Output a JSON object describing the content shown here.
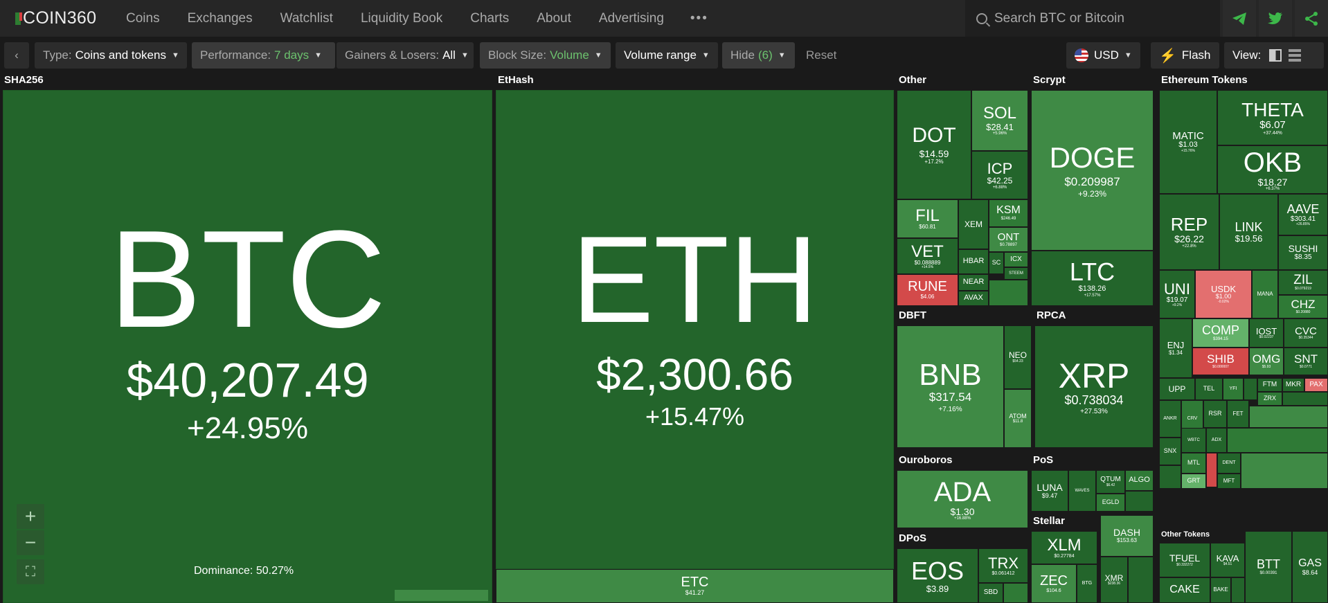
{
  "logo": {
    "text": "COIN360"
  },
  "nav": {
    "coins": "Coins",
    "exchanges": "Exchanges",
    "watchlist": "Watchlist",
    "liquidity": "Liquidity Book",
    "charts": "Charts",
    "about": "About",
    "advertising": "Advertising",
    "more": "•••"
  },
  "search": {
    "placeholder": "Search BTC or Bitcoin"
  },
  "toolbar": {
    "back": "‹",
    "type_label": "Type:",
    "type_value": "Coins and tokens",
    "perf_label": "Performance:",
    "perf_value": "7 days",
    "gl_label": "Gainers & Losers:",
    "gl_value": "All",
    "block_label": "Block Size:",
    "block_value": "Volume",
    "volume_range": "Volume range",
    "hide_label": "Hide",
    "hide_value": "(6)",
    "reset": "Reset",
    "currency": "USD",
    "flash": "Flash",
    "view": "View:"
  },
  "sections": {
    "sha256": "SHA256",
    "ethash": "EtHash",
    "other": "Other",
    "scrypt": "Scrypt",
    "eth_tokens": "Ethereum Tokens",
    "dbft": "DBFT",
    "rpca": "RPCA",
    "ouroboros": "Ouroboros",
    "pos": "PoS",
    "stellar": "Stellar",
    "dpos": "DPoS",
    "other_tokens": "Other Tokens"
  },
  "dominance": "Dominance: 50.27%",
  "tiles": {
    "btc": {
      "s": "BTC",
      "p": "$40,207.49",
      "c": "+24.95%"
    },
    "eth": {
      "s": "ETH",
      "p": "$2,300.66",
      "c": "+15.47%"
    },
    "etc": {
      "s": "ETC",
      "p": "$41.27"
    },
    "dot": {
      "s": "DOT",
      "p": "$14.59",
      "c": "+17.2%"
    },
    "sol": {
      "s": "SOL",
      "p": "$28.41",
      "c": "+5.96%"
    },
    "icp": {
      "s": "ICP",
      "p": "$42.25",
      "c": "+6.88%"
    },
    "fil": {
      "s": "FIL",
      "p": "$60.81",
      "c": "+4.9%"
    },
    "xem": {
      "s": "XEM"
    },
    "ksm": {
      "s": "KSM",
      "p": "$246.49"
    },
    "ont": {
      "s": "ONT",
      "p": "$0.78897"
    },
    "vet": {
      "s": "VET",
      "p": "$0.088889",
      "c": "+14.5%"
    },
    "hbar": {
      "s": "HBAR"
    },
    "sc": {
      "s": "SC"
    },
    "icx": {
      "s": "ICX"
    },
    "steem": {
      "s": "STEEM"
    },
    "rune": {
      "s": "RUNE",
      "p": "$4.06"
    },
    "near": {
      "s": "NEAR"
    },
    "avax": {
      "s": "AVAX"
    },
    "doge": {
      "s": "DOGE",
      "p": "$0.209987",
      "c": "+9.23%"
    },
    "ltc": {
      "s": "LTC",
      "p": "$138.26",
      "c": "+17.57%"
    },
    "matic": {
      "s": "MATIC",
      "p": "$1.03",
      "c": "+15.76%"
    },
    "theta": {
      "s": "THETA",
      "p": "$6.07",
      "c": "+37.44%"
    },
    "okb": {
      "s": "OKB",
      "p": "$18.27",
      "c": "+6.37%"
    },
    "rep": {
      "s": "REP",
      "p": "$26.22",
      "c": "+22.8%"
    },
    "link": {
      "s": "LINK",
      "p": "$19.56"
    },
    "aave": {
      "s": "AAVE",
      "p": "$303.41",
      "c": "+26.85%"
    },
    "sushi": {
      "s": "SUSHI",
      "p": "$8.35"
    },
    "uni": {
      "s": "UNI",
      "p": "$19.07",
      "c": "+9.2%"
    },
    "usdk": {
      "s": "USDK",
      "p": "$1.00",
      "c": "-0.02%"
    },
    "mana": {
      "s": "MANA"
    },
    "zil": {
      "s": "ZIL",
      "p": "$0.079219"
    },
    "chz": {
      "s": "CHZ",
      "p": "$0.20880"
    },
    "enj": {
      "s": "ENJ",
      "p": "$1.34"
    },
    "comp": {
      "s": "COMP",
      "p": "$394.15"
    },
    "iost": {
      "s": "IOST",
      "p": "$0.02237"
    },
    "cvc": {
      "s": "CVC",
      "p": "$0.35344"
    },
    "shib": {
      "s": "SHIB",
      "p": "$0.000007"
    },
    "omg": {
      "s": "OMG",
      "p": "$5.93"
    },
    "snt": {
      "s": "SNT",
      "p": "$0.0771"
    },
    "upp": {
      "s": "UPP"
    },
    "tel": {
      "s": "TEL"
    },
    "yfi": {
      "s": "YFI"
    },
    "ftm": {
      "s": "FTM"
    },
    "mkr": {
      "s": "MKR"
    },
    "pax": {
      "s": "PAX"
    },
    "zrx": {
      "s": "ZRX"
    },
    "ankr": {
      "s": "ANKR"
    },
    "crv": {
      "s": "CRV"
    },
    "rsr": {
      "s": "RSR"
    },
    "fet": {
      "s": "FET"
    },
    "snx": {
      "s": "SNX"
    },
    "wbtc": {
      "s": "WBTC"
    },
    "adx": {
      "s": "ADX"
    },
    "mtl": {
      "s": "MTL"
    },
    "dent": {
      "s": "DENT"
    },
    "grt": {
      "s": "GRT"
    },
    "mft": {
      "s": "MFT"
    },
    "bnb": {
      "s": "BNB",
      "p": "$317.54",
      "c": "+7.16%"
    },
    "neo": {
      "s": "NEO",
      "p": "$54.23"
    },
    "atom": {
      "s": "ATOM",
      "p": "$11.8"
    },
    "xrp": {
      "s": "XRP",
      "p": "$0.738034",
      "c": "+27.53%"
    },
    "ada": {
      "s": "ADA",
      "p": "$1.30",
      "c": "+16.88%"
    },
    "luna": {
      "s": "LUNA",
      "p": "$9.47"
    },
    "waves": {
      "s": "WAVES"
    },
    "qtum": {
      "s": "QTUM",
      "p": "$6.42"
    },
    "algo": {
      "s": "ALGO"
    },
    "egld": {
      "s": "EGLD"
    },
    "xlm": {
      "s": "XLM",
      "p": "$0.27784"
    },
    "dash": {
      "s": "DASH",
      "p": "$153.63"
    },
    "zec": {
      "s": "ZEC",
      "p": "$104.6"
    },
    "btg": {
      "s": "BTG"
    },
    "xmr": {
      "s": "XMR",
      "p": "$238.36"
    },
    "eos": {
      "s": "EOS",
      "p": "$3.89"
    },
    "trx": {
      "s": "TRX",
      "p": "$0.061412"
    },
    "sbd": {
      "s": "SBD"
    },
    "tfuel": {
      "s": "TFUEL",
      "p": "$0.332272"
    },
    "kava": {
      "s": "KAVA",
      "p": "$4.51"
    },
    "cake": {
      "s": "CAKE"
    },
    "bake": {
      "s": "BAKE"
    },
    "btt": {
      "s": "BTT",
      "p": "$0.00391"
    },
    "gas": {
      "s": "GAS",
      "p": "$8.64"
    }
  },
  "colors": {
    "nav_bg": "#262626",
    "accent_green": "#3db84a",
    "gain_dark": "#23652b",
    "gain_mid": "#3f8a45",
    "loss_red": "#d34a4a"
  }
}
